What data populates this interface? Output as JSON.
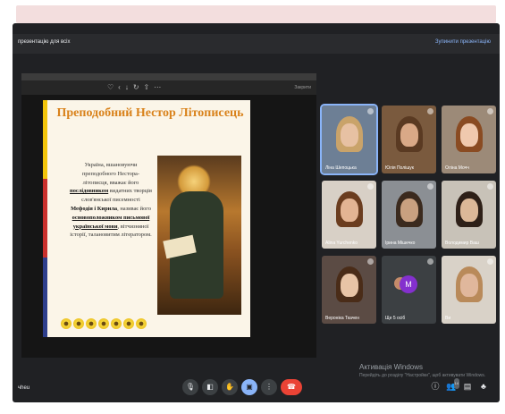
{
  "present_bar": {
    "message": "презентацію для всіх",
    "stop_label": "Зупинити презентацію"
  },
  "slide_toolbar": {
    "tools": [
      "♡",
      "‹",
      "↓",
      "↻",
      "⇧",
      "⋯"
    ],
    "right_label": "Закрити"
  },
  "slide": {
    "title": "Преподобний Нестор Літописець",
    "body": [
      {
        "t": "Україна, вшановуючи преподобного Нестора-літописця, вважає його ",
        "s": "n"
      },
      {
        "t": "послідовником",
        "s": "bu"
      },
      {
        "t": " видатних творців слов'янської писемності ",
        "s": "n"
      },
      {
        "t": "Мефодія і Кирила",
        "s": "b"
      },
      {
        "t": ", називає його ",
        "s": "n"
      },
      {
        "t": "основоположником письмової української мови",
        "s": "bu"
      },
      {
        "t": ", вітчизняної історії, талановитим літератором.",
        "s": "n"
      }
    ],
    "stripe_colors": [
      "#f2c40a",
      "#c9302c",
      "#2d3e8c"
    ],
    "title_color": "#d9821b"
  },
  "participants": [
    {
      "name": "Ліна Шепоцька",
      "active": true
    },
    {
      "name": "Юлія Полішук"
    },
    {
      "name": "Оліна Мочч"
    },
    {
      "name": "Alina Yurchenko"
    },
    {
      "name": "Ірина Мішечко"
    },
    {
      "name": "Володимир Ваш"
    },
    {
      "name": "Вероніка Ткачен"
    },
    {
      "name": "Ще 5 осіб",
      "avatar_letter": "M"
    },
    {
      "name": "Ви"
    }
  ],
  "windows_activation": {
    "title": "Активація Windows",
    "subtitle": "Перейдіть до розділу \"Настройки\", щоб активувати Windows."
  },
  "bottom_left_label": "чheu",
  "controls": {
    "mic": "🎙",
    "camera": "◧",
    "hand": "✋",
    "present": "▣",
    "more": "⋮",
    "hangup": "☎"
  },
  "right_icons": {
    "info": "ⓘ",
    "people": "👥",
    "people_count": "14",
    "chat": "▤",
    "activities": "♣"
  },
  "accent_colors": {
    "meet_blue": "#8ab4f8",
    "hangup_red": "#ea4335"
  }
}
